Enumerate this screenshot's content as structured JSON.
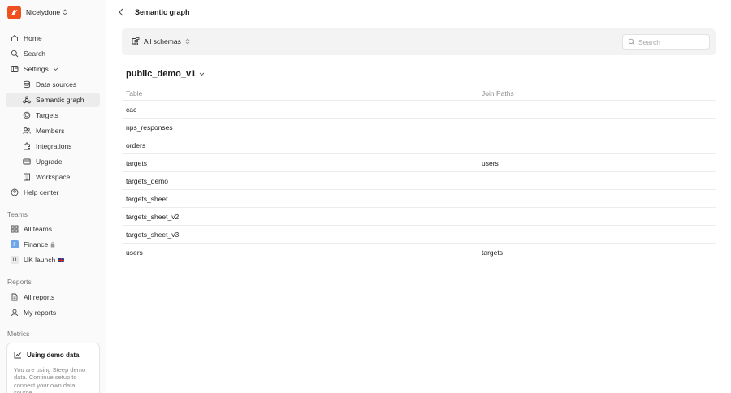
{
  "org": {
    "name": "Nicelydone"
  },
  "nav": {
    "home": "Home",
    "search": "Search",
    "settings": "Settings",
    "data_sources": "Data sources",
    "semantic_graph": "Semantic graph",
    "targets": "Targets",
    "members": "Members",
    "integrations": "Integrations",
    "upgrade": "Upgrade",
    "workspace": "Workspace",
    "help_center": "Help center"
  },
  "teams": {
    "label": "Teams",
    "all_teams": "All teams",
    "finance_badge": "F",
    "finance": "Finance",
    "uk_badge": "U",
    "uk_launch": "UK launch"
  },
  "reports": {
    "label": "Reports",
    "all_reports": "All reports",
    "my_reports": "My reports"
  },
  "metrics": {
    "label": "Metrics"
  },
  "demo_card": {
    "title": "Using demo data",
    "text": "You are using Steep demo data. Continue setup to connect your own data source."
  },
  "header": {
    "title": "Semantic graph"
  },
  "schema_bar": {
    "schema_select": "All schemas",
    "search_placeholder": "Search"
  },
  "schema": {
    "name": "public_demo_v1"
  },
  "table": {
    "headers": {
      "table": "Table",
      "join_paths": "Join Paths"
    },
    "rows": [
      {
        "table": "cac",
        "join_paths": ""
      },
      {
        "table": "nps_responses",
        "join_paths": ""
      },
      {
        "table": "orders",
        "join_paths": ""
      },
      {
        "table": "targets",
        "join_paths": "users"
      },
      {
        "table": "targets_demo",
        "join_paths": ""
      },
      {
        "table": "targets_sheet",
        "join_paths": ""
      },
      {
        "table": "targets_sheet_v2",
        "join_paths": ""
      },
      {
        "table": "targets_sheet_v3",
        "join_paths": ""
      },
      {
        "table": "users",
        "join_paths": "targets"
      }
    ]
  },
  "colors": {
    "brand": "#f0501e",
    "sidebar_bg": "#fafafa",
    "active_bg": "#ececec",
    "finance_badge": "#6ea6e8"
  }
}
